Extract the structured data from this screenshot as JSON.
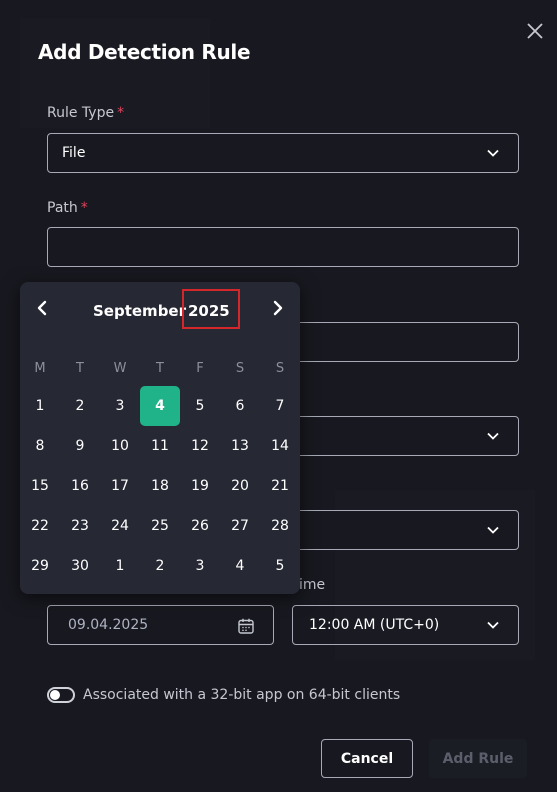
{
  "modal": {
    "title": "Add Detection Rule"
  },
  "form": {
    "rule_type_label": "Rule Type",
    "rule_type_value": "File",
    "path_label": "Path",
    "path_value": "",
    "required_mark": "*",
    "time_label": "ime",
    "date_value": "09.04.2025",
    "time_value": "12:00 AM (UTC+0)",
    "toggle_label": "Associated with a 32-bit app on 64-bit clients",
    "toggle_on": false
  },
  "buttons": {
    "cancel": "Cancel",
    "add_rule": "Add Rule"
  },
  "calendar": {
    "month": "September",
    "year": "2025",
    "weekdays": [
      "M",
      "T",
      "W",
      "T",
      "F",
      "S",
      "S"
    ],
    "selected_day": "4",
    "days": [
      [
        "1",
        "2",
        "3",
        "4",
        "5",
        "6",
        "7"
      ],
      [
        "8",
        "9",
        "10",
        "11",
        "12",
        "13",
        "14"
      ],
      [
        "15",
        "16",
        "17",
        "18",
        "19",
        "20",
        "21"
      ],
      [
        "22",
        "23",
        "24",
        "25",
        "26",
        "27",
        "28"
      ],
      [
        "29",
        "30",
        "1",
        "2",
        "3",
        "4",
        "5"
      ]
    ]
  },
  "colors": {
    "accent": "#20b38a",
    "required": "#e0445c",
    "highlight_box": "#d4272c"
  },
  "icons": {
    "close": "close-icon",
    "dropdown": "chevron-down-icon",
    "calendar": "calendar-icon",
    "prev": "chevron-left-icon",
    "next": "chevron-right-icon"
  }
}
